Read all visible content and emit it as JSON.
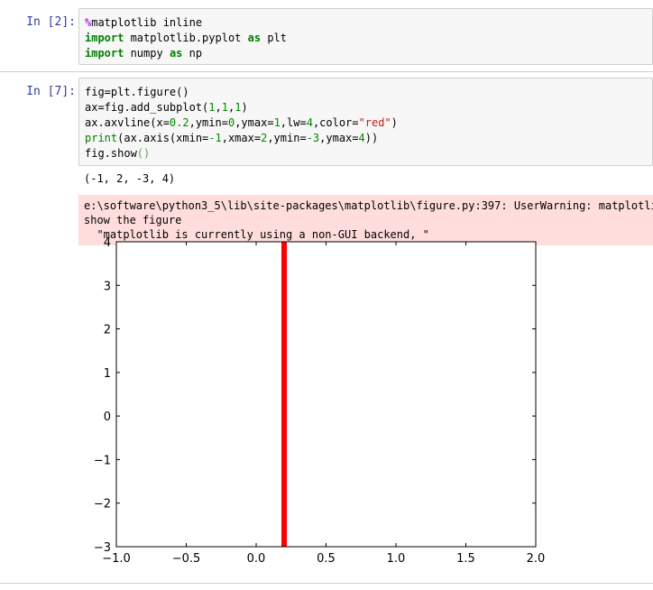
{
  "cells": [
    {
      "prompt": "In  [2]:",
      "lines": [
        [
          {
            "t": "%",
            "c": "magic"
          },
          {
            "t": "matplotlib inline",
            "c": ""
          }
        ],
        [
          {
            "t": "import",
            "c": "kw"
          },
          {
            "t": " matplotlib.pyplot ",
            "c": ""
          },
          {
            "t": "as",
            "c": "kw"
          },
          {
            "t": " plt",
            "c": ""
          }
        ],
        [
          {
            "t": "import",
            "c": "kw"
          },
          {
            "t": " numpy ",
            "c": ""
          },
          {
            "t": "as",
            "c": "kw"
          },
          {
            "t": " np",
            "c": ""
          }
        ]
      ]
    },
    {
      "prompt": "In  [7]:",
      "lines": [
        [
          {
            "t": "fig=plt.figure()",
            "c": ""
          }
        ],
        [
          {
            "t": "ax=fig.add_subplot(",
            "c": ""
          },
          {
            "t": "1",
            "c": "num"
          },
          {
            "t": ",",
            "c": ""
          },
          {
            "t": "1",
            "c": "num"
          },
          {
            "t": ",",
            "c": ""
          },
          {
            "t": "1",
            "c": "num"
          },
          {
            "t": ")",
            "c": ""
          }
        ],
        [
          {
            "t": "ax.axvline(x=",
            "c": ""
          },
          {
            "t": "0.2",
            "c": "num"
          },
          {
            "t": ",ymin=",
            "c": ""
          },
          {
            "t": "0",
            "c": "num"
          },
          {
            "t": ",ymax=",
            "c": ""
          },
          {
            "t": "1",
            "c": "num"
          },
          {
            "t": ",lw=",
            "c": ""
          },
          {
            "t": "4",
            "c": "num"
          },
          {
            "t": ",color=",
            "c": ""
          },
          {
            "t": "\"red\"",
            "c": "str"
          },
          {
            "t": ")",
            "c": ""
          }
        ],
        [
          {
            "t": "print",
            "c": "bi"
          },
          {
            "t": "(ax.axis(xmin=",
            "c": ""
          },
          {
            "t": "-1",
            "c": "num"
          },
          {
            "t": ",xmax=",
            "c": ""
          },
          {
            "t": "2",
            "c": "num"
          },
          {
            "t": ",ymin=",
            "c": ""
          },
          {
            "t": "-3",
            "c": "num"
          },
          {
            "t": ",ymax=",
            "c": ""
          },
          {
            "t": "4",
            "c": "num"
          },
          {
            "t": "))",
            "c": ""
          }
        ],
        [
          {
            "t": "fig.show",
            "c": ""
          },
          {
            "t": "()",
            "c": "paren-g"
          }
        ]
      ],
      "stdout": "(-1, 2, -3, 4)",
      "stderr": [
        "e:\\software\\python3_5\\lib\\site-packages\\matplotlib\\figure.py:397: UserWarning: matplotlib",
        "show the figure",
        "  \"matplotlib is currently using a non-GUI backend, \""
      ]
    }
  ],
  "chart_data": {
    "type": "line",
    "title": "",
    "xlabel": "",
    "ylabel": "",
    "xlim": [
      -1.0,
      2.0
    ],
    "ylim": [
      -3,
      4
    ],
    "xticks": [
      "−1.0",
      "−0.5",
      "0.0",
      "0.5",
      "1.0",
      "1.5",
      "2.0"
    ],
    "xtick_values": [
      -1.0,
      -0.5,
      0.0,
      0.5,
      1.0,
      1.5,
      2.0
    ],
    "yticks": [
      "−3",
      "−2",
      "−1",
      "0",
      "1",
      "2",
      "3",
      "4"
    ],
    "ytick_values": [
      -3,
      -2,
      -1,
      0,
      1,
      2,
      3,
      4
    ],
    "grid": false,
    "series": [
      {
        "kind": "axvline",
        "x": 0.2,
        "ymin_frac": 0,
        "ymax_frac": 1,
        "color": "#ff0000",
        "linewidth": 4
      }
    ]
  }
}
